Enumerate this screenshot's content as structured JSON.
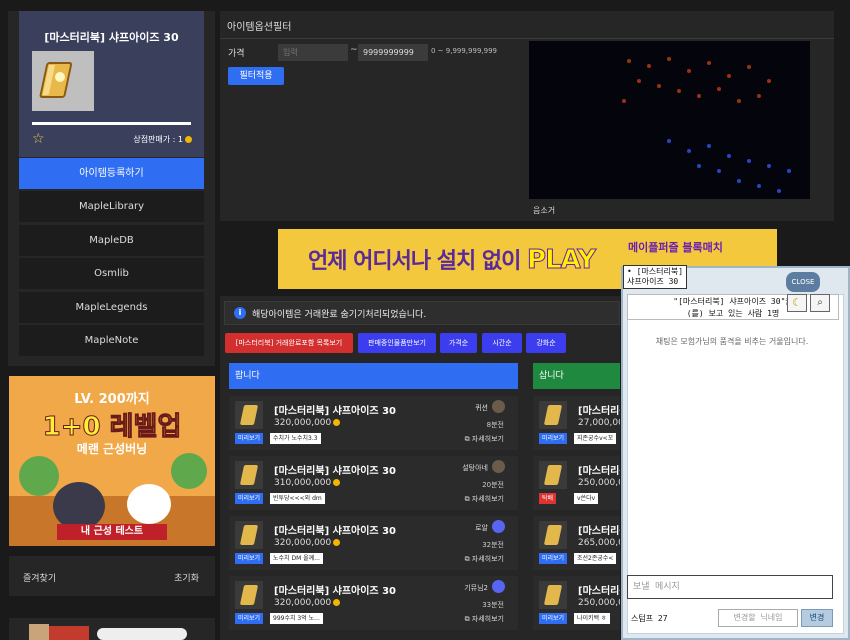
{
  "item": {
    "title": "[마스터리북] 샤프아이즈 30",
    "shop_price_label": "상점판매가 : 1"
  },
  "nav": {
    "register": "아이템등록하기",
    "items": [
      "MapleLibrary",
      "MapleDB",
      "Osmlib",
      "MapleLegends",
      "MapleNote"
    ]
  },
  "ad_left": {
    "line1": "LV. 200까지",
    "line2": "1+0 레벨업",
    "line3": "메랜 근성버닝",
    "line4": "내 근성 테스트"
  },
  "favorites": {
    "title": "즐겨찾기",
    "reset": "초기화"
  },
  "filter": {
    "title": "아이템옵션필터",
    "price_label": "가격",
    "min_placeholder": "입력",
    "max_value": "9999999999",
    "tilde": "~",
    "range_hint": "0 ~ 9,999,999,999",
    "apply": "필터적용",
    "mute": "음소거"
  },
  "banner": {
    "text_a": "언제 어디서나 설치 없이 ",
    "text_play": "PLAY",
    "right": "메이플퍼즐 블록매치"
  },
  "notice": {
    "icon": "i",
    "text": "해당아이템은 거래완료 숨기기처리되었습니다."
  },
  "tabs": [
    {
      "label": "[마스터리북] 거래완료포함 목록보기",
      "color": "#d32f2f"
    },
    {
      "label": "판매중인물품만보기",
      "color": "#3d3df0"
    },
    {
      "label": "가격순",
      "color": "#3d3df0"
    },
    {
      "label": "시간순",
      "color": "#3d3df0"
    },
    {
      "label": "강화순",
      "color": "#3d3df0"
    }
  ],
  "sell_header": "팝니다",
  "buy_header": "삽니다",
  "sell_rows": [
    {
      "name": "[마스터리북] 샤프아이즈 30",
      "price": "320,000,000",
      "seller": "퀴션",
      "count": "8분전",
      "preview": "미리보기",
      "memo": "수치가 노수치3.3",
      "detail": "자세히보기",
      "discord": false
    },
    {
      "name": "[마스터리북] 샤프아이즈 30",
      "price": "310,000,000",
      "seller": "설탕아네",
      "count": "20분전",
      "preview": "미리보기",
      "memo": "빈투당<<<외 dm",
      "detail": "자세히보기",
      "discord": false
    },
    {
      "name": "[마스터리북] 샤프아이즈 30",
      "price": "320,000,000",
      "seller": "로알",
      "count": "32분전",
      "preview": "미리보기",
      "memo": "노수치 DM 올께...",
      "detail": "자세히보기",
      "discord": true
    },
    {
      "name": "[마스터리북] 샤프아이즈 30",
      "price": "320,000,000",
      "seller": "기뮤님2",
      "count": "33분전",
      "preview": "미리보기",
      "memo": "999수치 3억 노...",
      "detail": "자세히보기",
      "discord": true
    }
  ],
  "buy_rows": [
    {
      "name": "[마스터리북]",
      "price": "27,000,000",
      "preview": "미리보기",
      "memo": "지존궁수v<꼬",
      "red": false
    },
    {
      "name": "[마스터리북]",
      "price": "250,000,0",
      "preview": "탁배",
      "memo": "v쓴다v",
      "red": true
    },
    {
      "name": "[마스터리북]",
      "price": "265,000,0",
      "preview": "미리보기",
      "memo": "조선2존궁수<",
      "red": false
    },
    {
      "name": "[마스터리북]",
      "price": "250,000,0",
      "preview": "미리보기",
      "memo": "나이키백 ㅎ",
      "red": false
    }
  ],
  "chat": {
    "tooltip_line1": "• [마스터리북]",
    "tooltip_line2": "샤프아이즈 30",
    "close": "CLOSE",
    "header_line1": "\"[마스터리북] 샤프아이즈 30\"을",
    "header_line2": "(를) 보고 있는 사람 1명",
    "message": "채팅은 모험가님의 품격을 비추는 거울입니다.",
    "input_placeholder": "보낼 메시지",
    "nick_label": "스텀프 27",
    "nick_placeholder": "변경할 닉네임",
    "nick_button": "변경"
  }
}
